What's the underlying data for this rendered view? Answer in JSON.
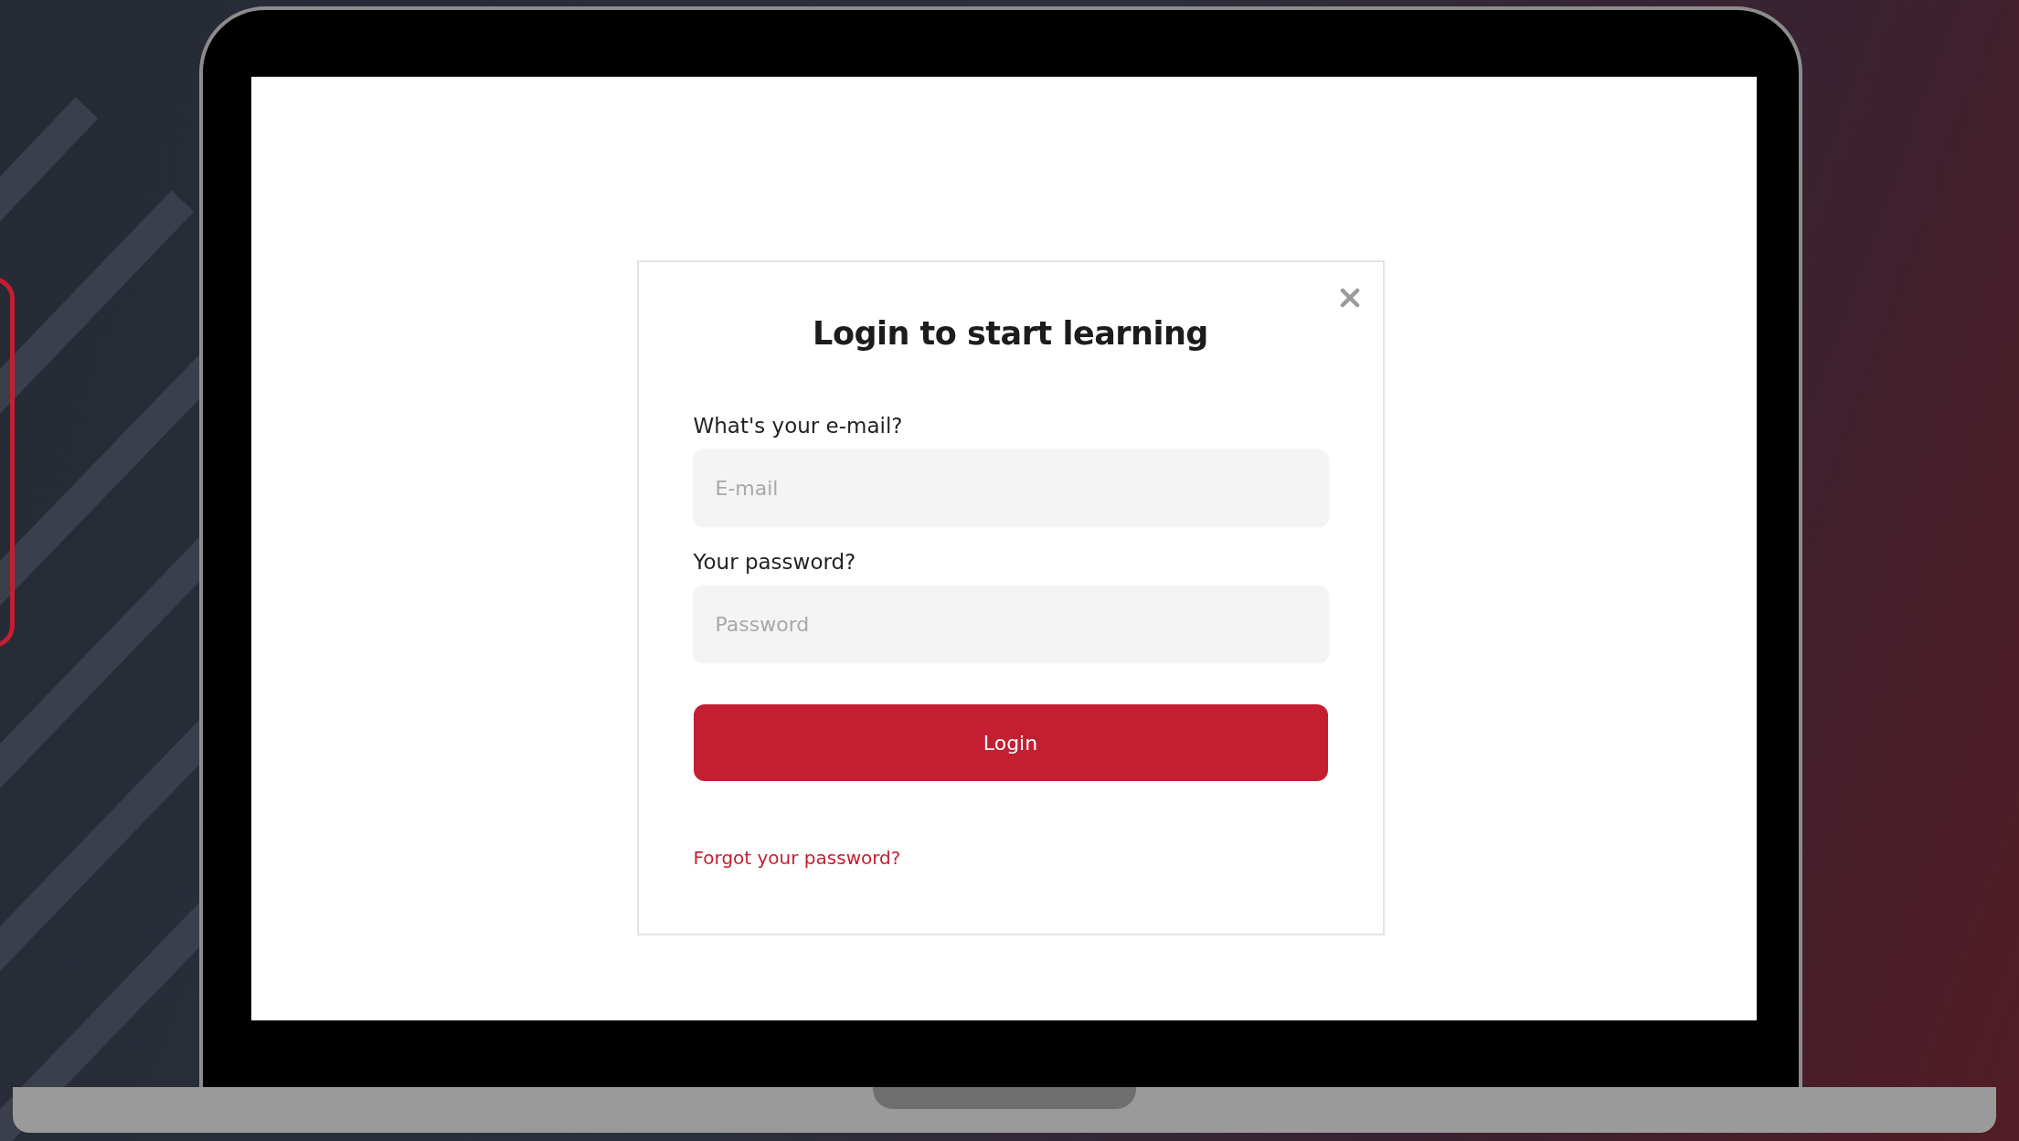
{
  "dialog": {
    "title": "Login to start learning",
    "fields": [
      {
        "label": "What's your e-mail?",
        "placeholder": "E-mail"
      },
      {
        "label": "Your password?",
        "placeholder": "Password"
      }
    ],
    "submit_button": "Login",
    "forgot_link": "Forgot your password?"
  }
}
